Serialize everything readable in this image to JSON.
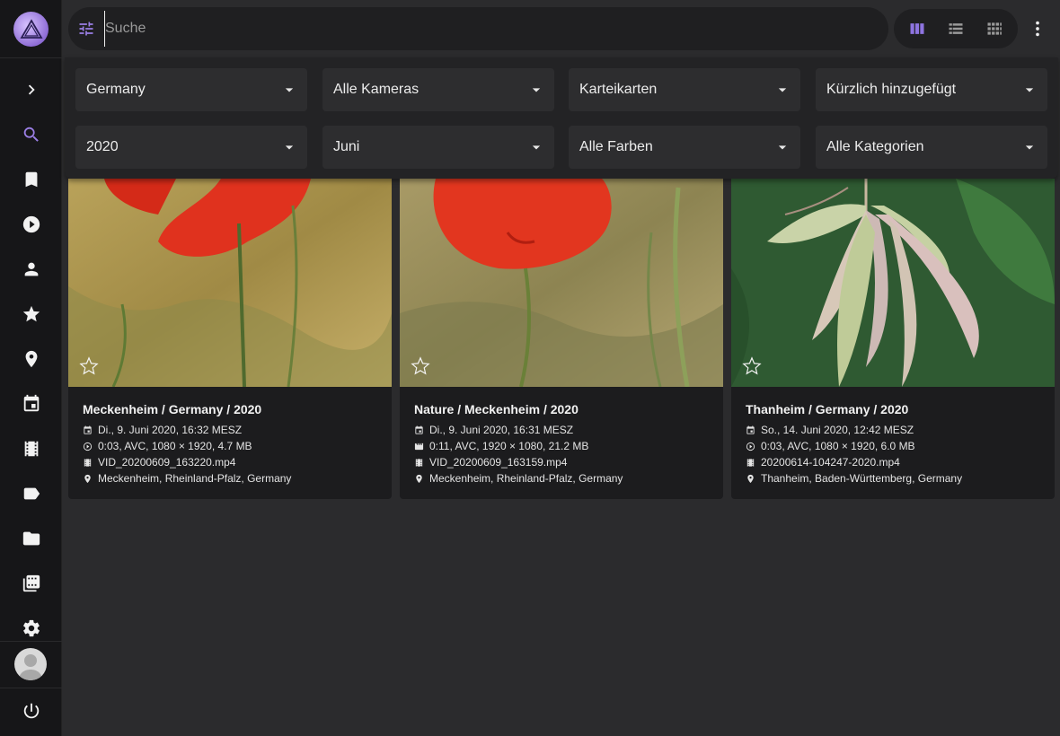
{
  "search": {
    "placeholder": "Suche"
  },
  "filters": [
    {
      "label": "Germany"
    },
    {
      "label": "Alle Kameras"
    },
    {
      "label": "Karteikarten"
    },
    {
      "label": "Kürzlich hinzugefügt"
    },
    {
      "label": "2020"
    },
    {
      "label": "Juni"
    },
    {
      "label": "Alle Farben"
    },
    {
      "label": "Alle Kategorien"
    }
  ],
  "cards": [
    {
      "title": "Meckenheim / Germany / 2020",
      "date": "Di., 9. Juni 2020, 16:32 MESZ",
      "video": "0:03, AVC, 1080 × 1920, 4.7 MB",
      "file": "VID_20200609_163220.mp4",
      "location": "Meckenheim, Rheinland-Pfalz, Germany"
    },
    {
      "title": "Nature / Meckenheim / 2020",
      "date": "Di., 9. Juni 2020, 16:31 MESZ",
      "video": "0:11, AVC, 1920 × 1080, 21.2 MB",
      "file": "VID_20200609_163159.mp4",
      "location": "Meckenheim, Rheinland-Pfalz, Germany"
    },
    {
      "title": "Thanheim / Germany / 2020",
      "date": "So., 14. Juni 2020, 12:42 MESZ",
      "video": "0:03, AVC, 1080 × 1920, 6.0 MB",
      "file": "20200614-104247-2020.mp4",
      "location": "Thanheim, Baden-Württemberg, Germany"
    }
  ],
  "colors": {
    "accent": "#9b7fe6",
    "sidebar": "#161618",
    "background": "#2b2b2d",
    "card": "#1c1c1e"
  }
}
